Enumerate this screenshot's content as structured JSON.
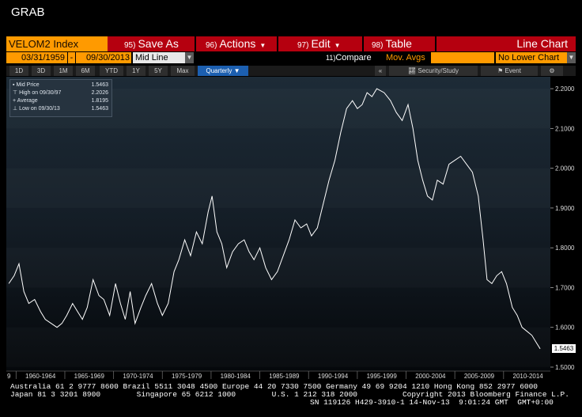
{
  "window": {
    "title": "GRAB"
  },
  "toolbar": {
    "ticker": "VELOM2 Index",
    "save_num": "95)",
    "save": "Save As",
    "actions_num": "96)",
    "actions": "Actions",
    "edit_num": "97)",
    "edit": "Edit",
    "table_num": "98)",
    "table": "Table",
    "view": "Line Chart"
  },
  "fields": {
    "start_date": "03/31/1959",
    "dash": "-",
    "end_date": "09/30/2013",
    "price_type": "Mid Line",
    "compare_num": "11)",
    "compare": "Compare",
    "mov_avgs": "Mov. Avgs",
    "lower_chart": "No Lower Chart"
  },
  "tabs": {
    "ranges": [
      "1D",
      "3D",
      "1M",
      "6M",
      "YTD",
      "1Y",
      "5Y",
      "Max"
    ],
    "period": "Quarterly",
    "collapse": "«",
    "security_study": "Security/Study",
    "event": "Event"
  },
  "legend": {
    "items": [
      {
        "label": "Mid Price",
        "value": "1.5463"
      },
      {
        "label": "High on 09/30/97",
        "value": "2.2026"
      },
      {
        "label": "Average",
        "value": "1.8195"
      },
      {
        "label": "Low on 09/30/13",
        "value": "1.5463"
      }
    ]
  },
  "colors": {
    "background": "#000000",
    "command_bar": "#b5000f",
    "ticker_field": "#ff9a00",
    "line": "#ffffff",
    "plot_top": "#1d2b37",
    "plot_bottom": "#060a0e"
  },
  "chart_data": {
    "type": "line",
    "title": "",
    "xlabel": "",
    "ylabel": "",
    "x_tick_labels": [
      "1960-1964",
      "1965-1969",
      "1970-1974",
      "1975-1979",
      "1980-1984",
      "1985-1989",
      "1990-1994",
      "1995-1999",
      "2000-2004",
      "2005-2009",
      "2010-2014"
    ],
    "x_edge_label": "9",
    "y_ticks": [
      1.5,
      1.6,
      1.7,
      1.8,
      1.9,
      2.0,
      2.1,
      2.2
    ],
    "y_tick_labels": [
      "1.5000",
      "1.6000",
      "1.7000",
      "1.8000",
      "1.9000",
      "2.0000",
      "2.1000",
      "2.2000"
    ],
    "ylim": [
      1.49,
      2.23
    ],
    "xlim": [
      1959.0,
      2014.8
    ],
    "last_value_label": "1.5463",
    "series": [
      {
        "x": [
          1959.25,
          1959.8,
          1960.3,
          1960.8,
          1961.3,
          1961.9,
          1962.5,
          1963.0,
          1963.6,
          1964.2,
          1964.7,
          1965.2,
          1965.8,
          1966.3,
          1966.8,
          1967.3,
          1967.9,
          1968.5,
          1969.0,
          1969.6,
          1970.2,
          1970.7,
          1971.2,
          1971.7,
          1972.2,
          1972.8,
          1973.3,
          1973.9,
          1974.5,
          1975.0,
          1975.6,
          1976.2,
          1976.7,
          1977.3,
          1977.9,
          1978.5,
          1979.1,
          1979.7,
          1980.1,
          1980.6,
          1981.1,
          1981.6,
          1982.2,
          1982.8,
          1983.4,
          1983.9,
          1984.4,
          1985.0,
          1985.6,
          1986.2,
          1986.8,
          1987.4,
          1988.0,
          1988.6,
          1989.2,
          1989.8,
          1990.3,
          1990.9,
          1991.5,
          1992.1,
          1992.7,
          1993.3,
          1993.9,
          1994.5,
          1995.0,
          1995.5,
          1996.0,
          1996.5,
          1997.0,
          1997.75,
          1998.4,
          1999.0,
          1999.6,
          2000.2,
          2000.7,
          2001.2,
          2001.7,
          2002.2,
          2002.7,
          2003.2,
          2003.8,
          2004.4,
          2005.0,
          2005.6,
          2006.2,
          2006.8,
          2007.4,
          2007.9,
          2008.3,
          2008.8,
          2009.3,
          2009.8,
          2010.3,
          2010.9,
          2011.4,
          2011.9,
          2012.4,
          2012.9,
          2013.4,
          2013.75
        ],
        "y": [
          1.71,
          1.73,
          1.76,
          1.69,
          1.66,
          1.67,
          1.64,
          1.62,
          1.61,
          1.6,
          1.61,
          1.63,
          1.66,
          1.64,
          1.62,
          1.65,
          1.72,
          1.68,
          1.67,
          1.63,
          1.71,
          1.66,
          1.62,
          1.69,
          1.61,
          1.65,
          1.68,
          1.71,
          1.66,
          1.63,
          1.66,
          1.74,
          1.77,
          1.82,
          1.78,
          1.84,
          1.81,
          1.89,
          1.93,
          1.84,
          1.81,
          1.75,
          1.79,
          1.81,
          1.82,
          1.79,
          1.77,
          1.8,
          1.75,
          1.72,
          1.74,
          1.78,
          1.82,
          1.87,
          1.85,
          1.86,
          1.83,
          1.85,
          1.91,
          1.97,
          2.02,
          2.09,
          2.15,
          2.17,
          2.15,
          2.16,
          2.19,
          2.18,
          2.2,
          2.19,
          2.17,
          2.14,
          2.12,
          2.16,
          2.1,
          2.02,
          1.97,
          1.93,
          1.92,
          1.97,
          1.96,
          2.01,
          2.02,
          2.03,
          2.01,
          1.99,
          1.93,
          1.82,
          1.72,
          1.71,
          1.73,
          1.74,
          1.71,
          1.65,
          1.63,
          1.6,
          1.59,
          1.58,
          1.56,
          1.546
        ]
      }
    ],
    "grid": false
  },
  "footer": {
    "line1": "Australia 61 2 9777 8600 Brazil 5511 3048 4500 Europe 44 20 7330 7500 Germany 49 69 9204 1210 Hong Kong 852 2977 6000",
    "line2": "Japan 81 3 3201 8900        Singapore 65 6212 1000        U.S. 1 212 318 2000          Copyright 2013 Bloomberg Finance L.P.",
    "line3": "SN 119126 H429-3910-1 14-Nov-13  9:01:24 GMT  GMT+0:00"
  }
}
